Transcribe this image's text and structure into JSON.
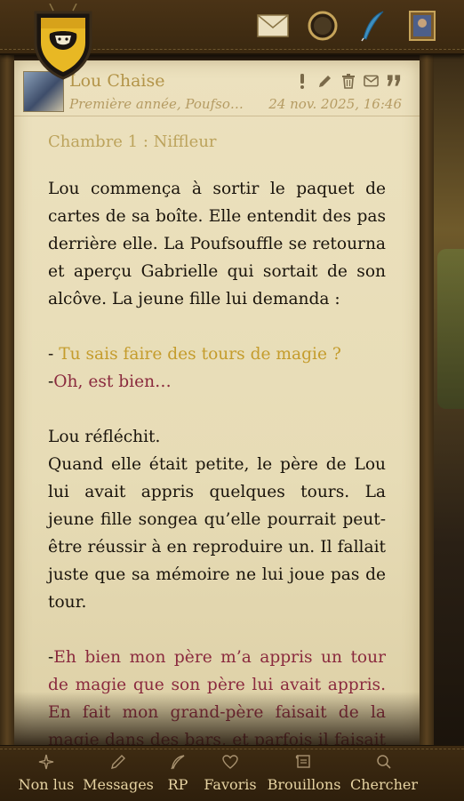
{
  "post": {
    "author": "Lou Chaise",
    "subtitle": "Première année, Poufso…",
    "date": "24 nov. 2025, 16:46",
    "room": "Chambre 1 : Niffleur",
    "paragraph1": "Lou commença à sortir le paquet de cartes de sa boîte. Elle entendit des pas derrière elle. La Poufsouffle se retourna et aperçu Gabrielle qui sortait de son alcôve. La jeune fille lui demanda :",
    "dialogue1_dash": "- ",
    "dialogue1_text": "Tu sais faire des tours de magie ?",
    "dialogue2_dash": "-",
    "dialogue2_text": "Oh, est bien…",
    "reflect": "Lou réfléchit.",
    "paragraph2": "Quand elle était petite, le père de Lou lui avait appris quelques tours. La jeune fille songea qu’elle pourrait peut-être réussir à en reproduire un. Il fallait juste que sa mémoire ne lui joue pas de tour.",
    "dialogue3_dash": "-",
    "dialogue3_text": "Eh bien mon père m’a appris un tour de magie que son père lui avait appris. En fait mon grand-père faisait de la magie dans des bars, et parfois il faisait des"
  },
  "nav": {
    "unread": "Non lus",
    "messages": "Messages",
    "rp": "RP",
    "favorites": "Favoris",
    "drafts": "Brouillons",
    "search": "Chercher"
  },
  "colors": {
    "gold_text": "#c49c2c",
    "maroon_text": "#8a2a3e",
    "parchment": "#e7dcb6",
    "wood": "#3a2810",
    "crest_yellow": "#e8b824"
  },
  "icons": {
    "top": [
      "envelope-icon",
      "crystal-ball-icon",
      "quill-icon",
      "portrait-icon"
    ],
    "actions": [
      "exclamation-icon",
      "pencil-icon",
      "trash-icon",
      "mail-icon",
      "quote-icon"
    ],
    "nav": [
      "sparkle-icon",
      "pencil-icon",
      "feather-icon",
      "heart-icon",
      "scroll-icon",
      "search-icon"
    ]
  }
}
